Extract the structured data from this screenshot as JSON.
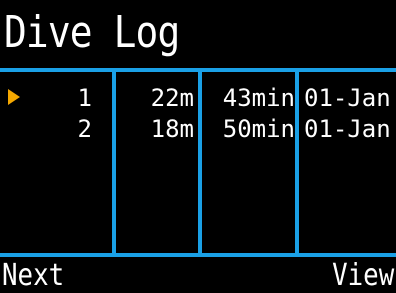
{
  "header": {
    "title": "Dive Log"
  },
  "table": {
    "rows": [
      {
        "selected": true,
        "number": "1",
        "depth": "22m",
        "duration": "43min",
        "date": "01-Jan"
      },
      {
        "selected": false,
        "number": "2",
        "depth": "18m",
        "duration": "50min",
        "date": "01-Jan"
      }
    ]
  },
  "footer": {
    "left_label": "Next",
    "right_label": "View"
  },
  "colors": {
    "background": "#000000",
    "grid_lines": "#1aa0e6",
    "selection_marker": "#f5a800",
    "text": "#ffffff"
  },
  "icons": {
    "selection_marker": "triangle-right-icon"
  }
}
